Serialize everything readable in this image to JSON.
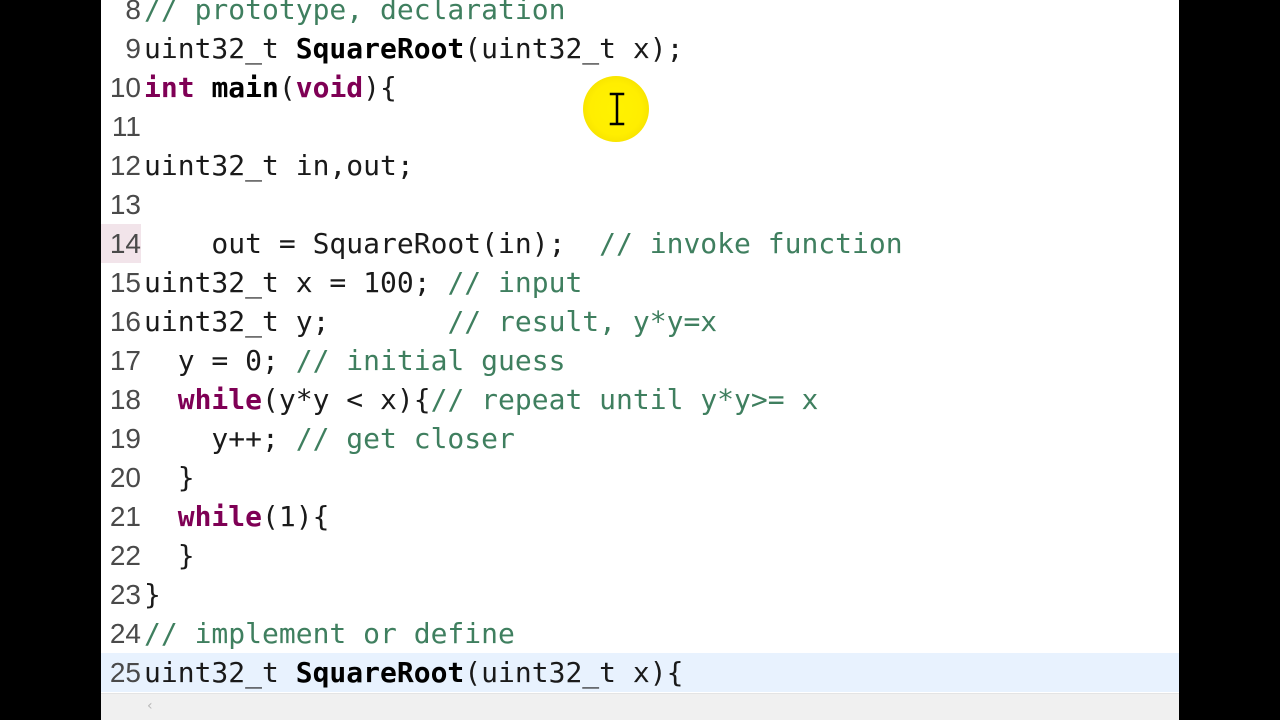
{
  "editor": {
    "lines": [
      {
        "num": "8",
        "tokens": [
          {
            "t": "// prototype, declaration",
            "c": "cm"
          }
        ]
      },
      {
        "num": "9",
        "tokens": [
          {
            "t": "uint32_t ",
            "c": "plain"
          },
          {
            "t": "SquareRoot",
            "c": "fn"
          },
          {
            "t": "(uint32_t x);",
            "c": "plain"
          }
        ]
      },
      {
        "num": "10",
        "tokens": [
          {
            "t": "int",
            "c": "kw"
          },
          {
            "t": " ",
            "c": "plain"
          },
          {
            "t": "main",
            "c": "fn"
          },
          {
            "t": "(",
            "c": "plain"
          },
          {
            "t": "void",
            "c": "kw"
          },
          {
            "t": "){",
            "c": "plain"
          }
        ]
      },
      {
        "num": "11",
        "tokens": []
      },
      {
        "num": "12",
        "tokens": [
          {
            "t": "uint32_t in,out;",
            "c": "plain"
          }
        ]
      },
      {
        "num": "13",
        "tokens": []
      },
      {
        "num": "14",
        "tokens": [
          {
            "t": "    out = SquareRoot(in);  ",
            "c": "plain"
          },
          {
            "t": "// invoke function",
            "c": "cm"
          }
        ]
      },
      {
        "num": "15",
        "tokens": [
          {
            "t": "uint32_t x = 100; ",
            "c": "plain"
          },
          {
            "t": "// input",
            "c": "cm"
          }
        ]
      },
      {
        "num": "16",
        "tokens": [
          {
            "t": "uint32_t y;       ",
            "c": "plain"
          },
          {
            "t": "// result, y*y=x",
            "c": "cm"
          }
        ]
      },
      {
        "num": "17",
        "tokens": [
          {
            "t": "  y = 0; ",
            "c": "plain"
          },
          {
            "t": "// initial guess",
            "c": "cm"
          }
        ]
      },
      {
        "num": "18",
        "tokens": [
          {
            "t": "  ",
            "c": "plain"
          },
          {
            "t": "while",
            "c": "kw"
          },
          {
            "t": "(y*y < x){",
            "c": "plain"
          },
          {
            "t": "// repeat until y*y>= x",
            "c": "cm"
          }
        ]
      },
      {
        "num": "19",
        "tokens": [
          {
            "t": "    y++; ",
            "c": "plain"
          },
          {
            "t": "// get closer",
            "c": "cm"
          }
        ]
      },
      {
        "num": "20",
        "tokens": [
          {
            "t": "  }",
            "c": "plain"
          }
        ]
      },
      {
        "num": "21",
        "tokens": [
          {
            "t": "  ",
            "c": "plain"
          },
          {
            "t": "while",
            "c": "kw"
          },
          {
            "t": "(1){",
            "c": "plain"
          }
        ]
      },
      {
        "num": "22",
        "tokens": [
          {
            "t": "  }",
            "c": "plain"
          }
        ]
      },
      {
        "num": "23",
        "tokens": [
          {
            "t": "}",
            "c": "plain"
          }
        ]
      },
      {
        "num": "24",
        "tokens": [
          {
            "t": "// implement or define",
            "c": "cm"
          }
        ]
      },
      {
        "num": "25",
        "tokens": [
          {
            "t": "uint32_t ",
            "c": "plain"
          },
          {
            "t": "SquareRoot",
            "c": "fn"
          },
          {
            "t": "(uint32_t x){",
            "c": "plain"
          }
        ]
      }
    ],
    "current_line": "25",
    "highlighted_gutter_line": "14"
  },
  "scrollbar": {
    "left_arrow": "‹"
  },
  "colors": {
    "keyword": "#7f0055",
    "comment": "#3f7f5f",
    "current_line_bg": "#e8f2fe",
    "cursor_highlight": "#fff200"
  },
  "icons": {
    "cursor": "text-ibeam-icon",
    "scroll_left": "chevron-left-icon"
  }
}
